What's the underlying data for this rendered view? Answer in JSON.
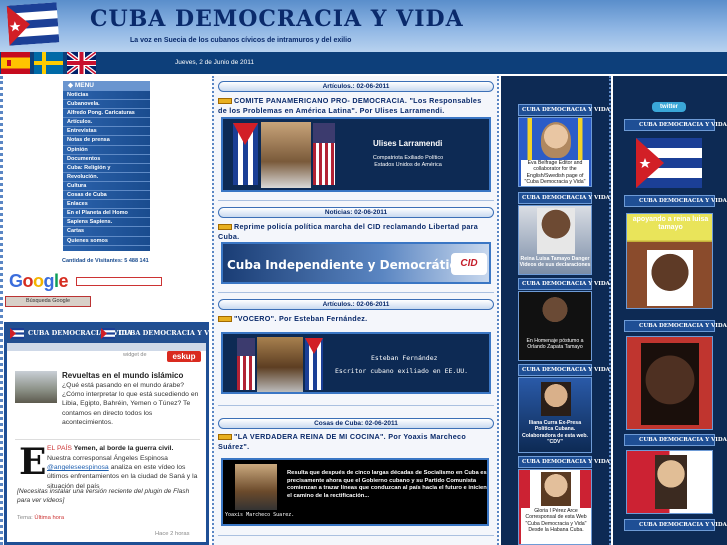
{
  "header": {
    "title": "CUBA DEMOCRACIA Y VIDA",
    "tagline": "La voz en Suecia de los cubanos cívicos de intramuros y del exilio",
    "date": "Jueves, 2 de Junio de 2011"
  },
  "language_flags": [
    {
      "name": "spanish-flag"
    },
    {
      "name": "swedish-flag"
    },
    {
      "name": "english-flag"
    }
  ],
  "menu": {
    "heading": "MENU",
    "items": [
      "Noticias",
      "Cubanovela.",
      "Alfredo Pong. Caricaturas",
      "Artículos.",
      "Entrevistas",
      "Notas de prensa",
      "Opinión",
      "Documentos",
      "Cuba: Religión y",
      "Revolución.",
      "Cultura",
      "Cosas de Cuba",
      "Enlaces",
      "En el Planeta del Homo",
      "Sapiens Sapiens.",
      "Cartas",
      "Quienes somos"
    ]
  },
  "visits": "Cantidad de Visitantes: 5 488 141",
  "google": {
    "logo": "Google",
    "button": "Búsqueda Google"
  },
  "widget": {
    "banner": "CUBA DEMOCRACIA Y VIDA",
    "banner2": "CUBA DEMOCRACIA Y VIDA",
    "powered": "widget de",
    "powered_logo": "eskup",
    "feed1": {
      "title": "Revueltas en el mundo islámico",
      "text": "¿Qué está pasando en el mundo árabe? ¿Cómo interpretar lo que está sucediendo en Libia, Egipto, Bahréin, Yemen o Túnez? Te contamos en directo todos los acontecimientos."
    },
    "feed2": {
      "source": "EL PAÍS",
      "headline": "Yemen, al borde la guerra civil.",
      "text_a": "Nuestra corresponsal Ángeles Espinosa",
      "handle": "@angeleseespinosa",
      "text_b": "analiza en este vídeo los últimos enfrentamientos en la ciudad de Saná y la situación del país",
      "italic": "[Necesitas instalar una versión reciente del plugin de Flash para ver vídeos]",
      "tema_label": "Tema:",
      "tema_value": "Última hora",
      "time": "Hace 2 horas"
    }
  },
  "articles": [
    {
      "section": "Artículos.: 02-06-2011",
      "title": "COMITE PANAMERICANO PRO- DEMOCRACIA. \"Los Responsables de los Problemas en América Latina\". Por Ulises Larramendi.",
      "image_name": "Ulises Larramendi",
      "image_sub": "Compatriota Exiliado Político Estados Unidos de América"
    },
    {
      "section": "Noticias: 02-06-2011",
      "title": "Reprime policía política marcha del CID reclamando Libertad para Cuba.",
      "image_name": "Cuba Independiente y Democrática",
      "image_sub": "CID"
    },
    {
      "section": "Artículos.: 02-06-2011",
      "title": "\"VOCERO\". Por Esteban Fernández.",
      "image_name": "Esteban Fernández",
      "image_sub": "Escritor cubano exiliado en EE.UU."
    },
    {
      "section": "Cosas de Cuba: 02-06-2011",
      "title": "\"LA VERDADERA REINA DE MI COCINA\". Por Yoaxis Marcheco Suárez\".",
      "image_name": "Yoaxis Marcheco Suarez.",
      "image_sub": "Resulta que después de cinco largas décadas de Socialismo en Cuba es precisamente ahora que el Gobierno cubano y su Partido Comunista comienzan a trazar líneas que conduzcan al país hacia el futuro e inicien el camino de la rectificación..."
    }
  ],
  "right_col": {
    "banner": "CUBA DEMOCRACIA Y VIDA",
    "items": [
      {
        "caption": "Eva Belfrage Editor and collaborator for the English/Swedish page of \"Cuba Democracia y Vida\""
      },
      {
        "caption": "Reina Luisa Tamayo Danger Videos de sus declaraciones"
      },
      {
        "caption": "En Homenaje póstumo a Orlando Zapata Tamayo"
      },
      {
        "caption": "Iliana Curra Ex-Presa Política Cubana. Colaboradora de esta web. \"CDV\""
      },
      {
        "caption": "Gloria I Pérez Arce Corresponsal de esta Web \"Cuba Democracia y Vida\" Desde la Habana Cuba."
      }
    ]
  },
  "far_right_col": {
    "twitter": "twitter",
    "banner": "CUBA DEMOCRACIA Y VIDA",
    "tamayo": "apoyando a reina luisa tamayo"
  }
}
